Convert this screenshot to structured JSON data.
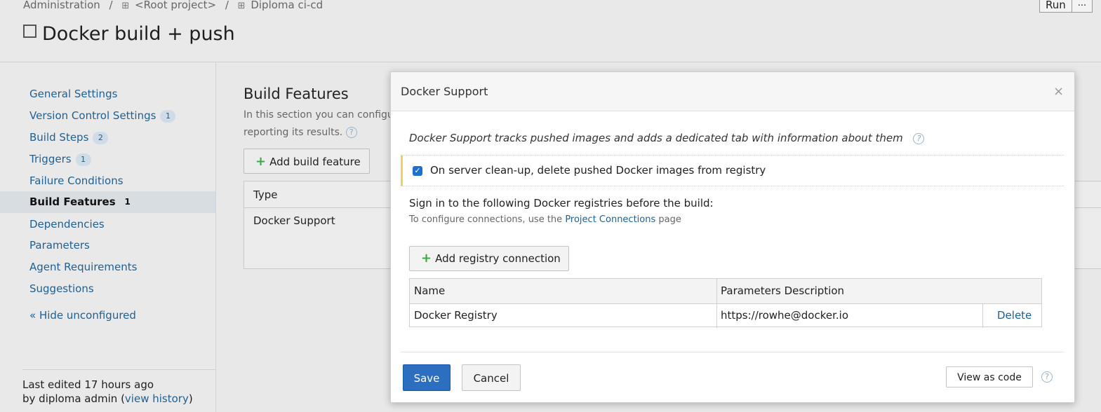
{
  "breadcrumb": {
    "items": [
      "Administration",
      "<Root project>",
      "Diploma ci-cd"
    ],
    "separator": "/",
    "grid_glyph": "⊞"
  },
  "header": {
    "title": "Docker build + push",
    "run_label": "Run",
    "more_label": "..."
  },
  "sidebar": {
    "items": [
      {
        "label": "General Settings",
        "badge": ""
      },
      {
        "label": "Version Control Settings",
        "badge": "1"
      },
      {
        "label": "Build Steps",
        "badge": "2"
      },
      {
        "label": "Triggers",
        "badge": "1"
      },
      {
        "label": "Failure Conditions",
        "badge": ""
      },
      {
        "label": "Build Features",
        "badge": "1",
        "active": true
      },
      {
        "label": "Dependencies",
        "badge": ""
      },
      {
        "label": "Parameters",
        "badge": ""
      },
      {
        "label": "Agent Requirements",
        "badge": ""
      },
      {
        "label": "Suggestions",
        "badge": ""
      }
    ],
    "hide_link": "« Hide unconfigured",
    "last_edited_prefix": "Last edited",
    "last_edited_time": "17 hours ago",
    "by_prefix": "by diploma admin",
    "history_link": "view history"
  },
  "main": {
    "title": "Build Features",
    "desc_line1": "In this section you can configure",
    "desc_line2": "reporting its results.",
    "add_button": "Add build feature",
    "table_header": "Type",
    "table_row": "Docker Support"
  },
  "dialog": {
    "title": "Docker Support",
    "close_glyph": "×",
    "description": "Docker Support tracks pushed images and adds a dedicated tab with information about them",
    "cleanup_checked": true,
    "cleanup_label": "On server clean-up, delete pushed Docker images from registry",
    "signin_text": "Sign in to the following Docker registries before the build:",
    "configure_prefix": "To configure connections, use the",
    "configure_link": "Project Connections",
    "configure_suffix": "page",
    "add_registry": "Add registry connection",
    "registry_table": {
      "headers": [
        "Name",
        "Parameters Description"
      ],
      "rows": [
        {
          "name": "Docker Registry",
          "params": "https://rowhe@docker.io",
          "action": "Delete"
        }
      ]
    },
    "save": "Save",
    "cancel": "Cancel",
    "view_code": "View as code",
    "help_glyph": "?"
  },
  "colors": {
    "accent": "#2c6ec0",
    "link": "#1f5f91",
    "plus": "#3aa845",
    "warning_bar": "#f3cf5a"
  },
  "icons": [
    "grid-icon",
    "checkbox-icon",
    "help-icon",
    "close-icon",
    "plus-icon"
  ]
}
